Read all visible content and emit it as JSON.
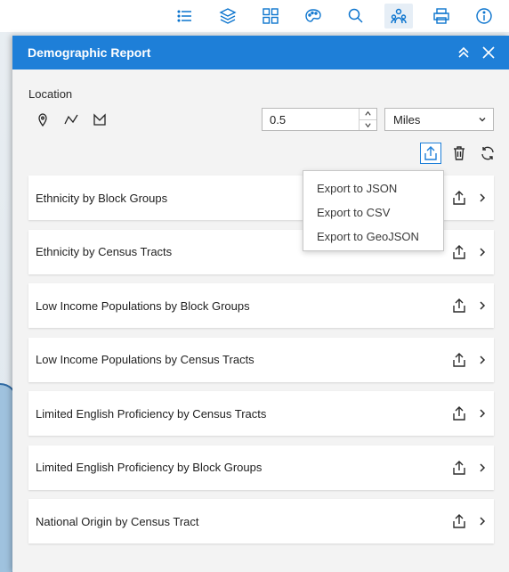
{
  "toolbar": {
    "icons": [
      "list-icon",
      "layers-icon",
      "grid-icon",
      "palette-icon",
      "search-icon",
      "demographic-icon",
      "print-icon",
      "info-icon"
    ],
    "active": "demographic-icon",
    "accent": "#0b74ce"
  },
  "panel": {
    "title": "Demographic Report",
    "header_color": "#1e7fd8",
    "location_label": "Location",
    "distance_value": "0.5",
    "units_value": "Miles"
  },
  "export_menu": {
    "items": [
      "Export to JSON",
      "Export to CSV",
      "Export to GeoJSON"
    ]
  },
  "reports": [
    "Ethnicity by Block Groups",
    "Ethnicity by Census Tracts",
    "Low Income Populations by Block Groups",
    "Low Income Populations by Census Tracts",
    "Limited English Proficiency by Census Tracts",
    "Limited English Proficiency by Block Groups",
    "National Origin by Census Tract"
  ]
}
